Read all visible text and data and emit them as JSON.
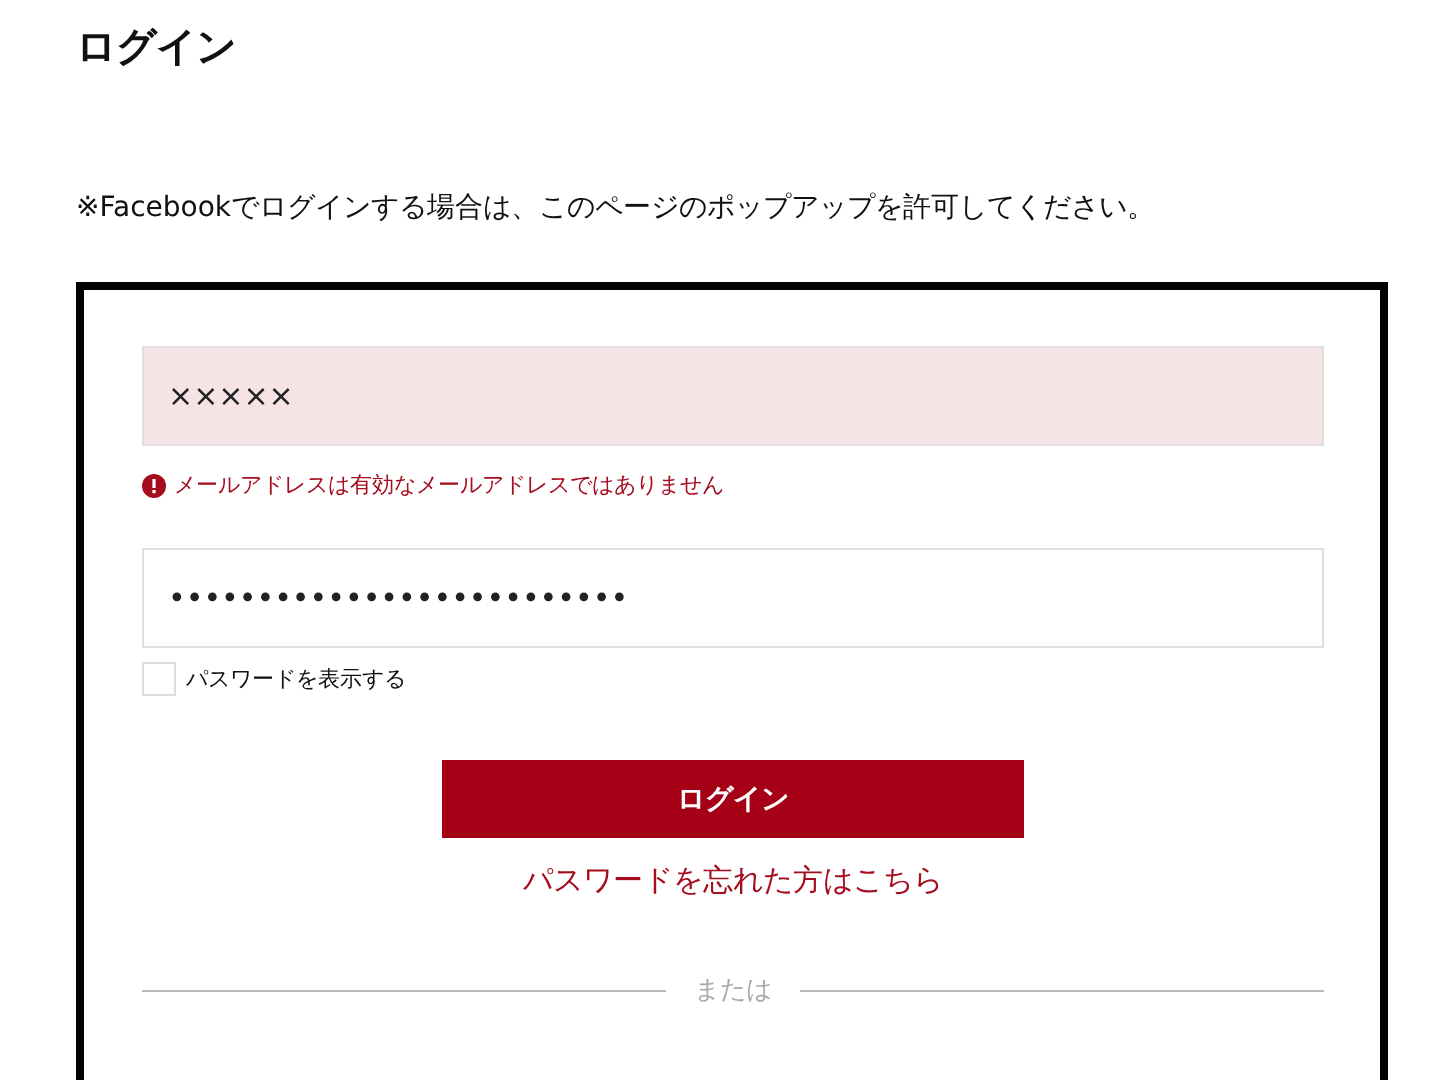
{
  "title": "ログイン",
  "notice": "※Facebookでログインする場合は、このページのポップアップを許可してください。",
  "email": {
    "value": "×××××",
    "invalid": true,
    "error": "メールアドレスは有効なメールアドレスではありません"
  },
  "password": {
    "value": "••••••••••••••••••••••••••"
  },
  "show_password": {
    "label": "パスワードを表示する",
    "checked": false
  },
  "login_button": "ログイン",
  "forgot_link": "パスワードを忘れた方はこちら",
  "divider": "または"
}
